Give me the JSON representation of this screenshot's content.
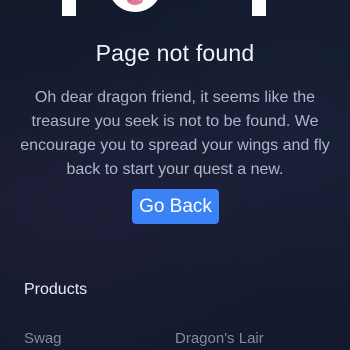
{
  "page": {
    "title": "Page not found",
    "message": "Oh dear dragon friend, it seems like the treasure you seek is not to be found. We encourage you to spread your wings and fly back to start your quest a new.",
    "go_back_label": "Go Back",
    "accent_color": "#3b82f6",
    "background_color": "#141a2c"
  },
  "footer": {
    "heading": "Products",
    "links": [
      {
        "label": "Swag"
      },
      {
        "label": "Dragon's Lair"
      }
    ]
  },
  "icons": {
    "hero": "dragon-icon"
  }
}
